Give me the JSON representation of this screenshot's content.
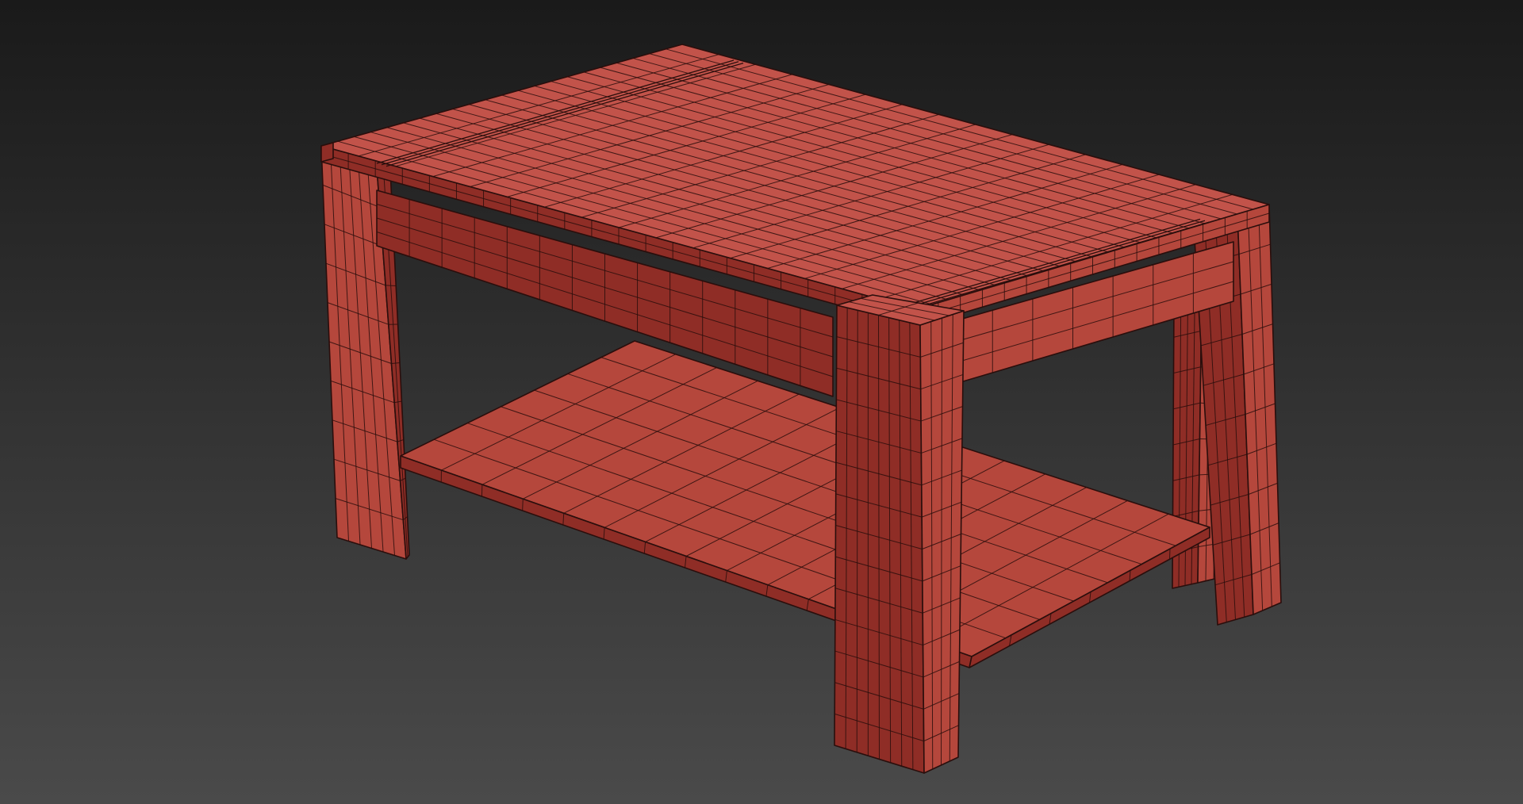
{
  "viewport": {
    "name": "3d-viewport",
    "background_top": "#1a1a1a",
    "background_bottom": "#4a4a4a"
  },
  "model": {
    "name": "coffee-table-wireframe-mesh",
    "face_color": "#b5473c",
    "face_light": "#c2534a",
    "face_dark": "#8f2d26",
    "wire_color": "#2a0e0c",
    "parts": [
      "tabletop",
      "apron",
      "lower-shelf",
      "leg-front",
      "leg-left",
      "leg-right",
      "leg-back"
    ]
  }
}
